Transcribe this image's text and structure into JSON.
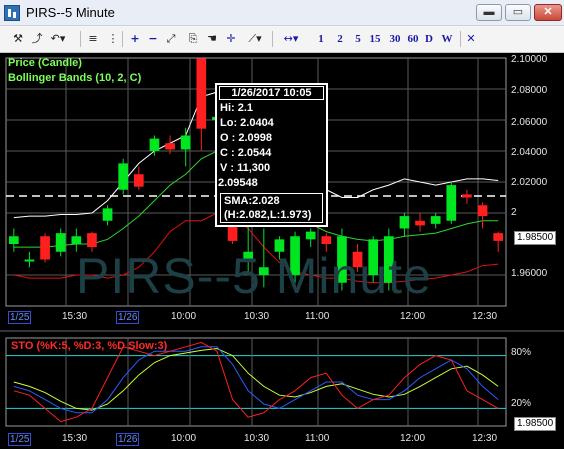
{
  "window": {
    "title": "PIRS--5 Minute",
    "buttons": [
      "▭",
      "▭",
      "✕"
    ]
  },
  "toolbar": {
    "icons": [
      "wrench-icon",
      "line-chart-icon",
      "undo-icon",
      "align-icon",
      "zoom-in-icon",
      "zoom-out-icon",
      "fit-icon",
      "hand-icon",
      "crosshair-icon",
      "draw-line-icon",
      "scroll-icon"
    ],
    "intervals": [
      "1",
      "2",
      "5",
      "15",
      "30",
      "60",
      "D",
      "W"
    ],
    "close": "✕"
  },
  "legend": {
    "price": "Price (Candle)",
    "bollinger": "Bollinger Bands (10, 2, C)"
  },
  "y_axis": [
    "2.10000",
    "2.08000",
    "2.06000",
    "2.04000",
    "2.02000",
    "2",
    "1.96000"
  ],
  "sto_axis": [
    "80%",
    "20%"
  ],
  "time_labels": [
    "15:30",
    "10:00",
    "10:30",
    "11:00",
    "12:00",
    "12:30"
  ],
  "date_labels": [
    "1/25",
    "1/26"
  ],
  "price_tag": "1.98500",
  "sto_tag": "1.98500",
  "tooltip": {
    "header": "1/26/2017 10:05",
    "hi": "Hi:  2.1",
    "lo": "Lo:  2.0404",
    "open": "O :  2.0998",
    "close": "C :  2.0544",
    "volume": "V :  11,300",
    "extra": "2.09548",
    "sma": "SMA:2.028",
    "sma_range": "(H:2.082,L:1.973)"
  },
  "watermark": "PIRS--5 Minute",
  "sto_label": "STO (%K:5, %D:3, %D Slow:3)",
  "colors": {
    "up": "#00e620",
    "down": "#ff1f1f",
    "bb_upper": "#ffffff",
    "bb_mid": "#2fd52f",
    "bb_lower": "#e01010",
    "grid": "#9a9a9a"
  },
  "chart_data": {
    "type": "candlestick",
    "ylim": [
      1.94,
      2.1
    ],
    "candles": [
      {
        "o": 1.98,
        "h": 1.99,
        "l": 1.975,
        "c": 1.985
      },
      {
        "o": 1.97,
        "h": 1.975,
        "l": 1.965,
        "c": 1.97
      },
      {
        "o": 1.985,
        "h": 1.987,
        "l": 1.968,
        "c": 1.97
      },
      {
        "o": 1.975,
        "h": 1.99,
        "l": 1.972,
        "c": 1.987
      },
      {
        "o": 1.98,
        "h": 1.99,
        "l": 1.975,
        "c": 1.985
      },
      {
        "o": 1.987,
        "h": 1.988,
        "l": 1.975,
        "c": 1.978
      },
      {
        "o": 1.995,
        "h": 2.005,
        "l": 1.992,
        "c": 2.003
      },
      {
        "o": 2.015,
        "h": 2.035,
        "l": 2.012,
        "c": 2.032
      },
      {
        "o": 2.025,
        "h": 2.03,
        "l": 2.015,
        "c": 2.017
      },
      {
        "o": 2.04,
        "h": 2.05,
        "l": 2.037,
        "c": 2.048
      },
      {
        "o": 2.045,
        "h": 2.05,
        "l": 2.038,
        "c": 2.041
      },
      {
        "o": 2.041,
        "h": 2.055,
        "l": 2.03,
        "c": 2.05
      },
      {
        "o": 2.0998,
        "h": 2.1,
        "l": 2.0404,
        "c": 2.0544
      },
      {
        "o": 2.06,
        "h": 2.07,
        "l": 2.055,
        "c": 2.062
      },
      {
        "o": 1.995,
        "h": 2.0,
        "l": 1.98,
        "c": 1.982
      },
      {
        "o": 1.97,
        "h": 2.0,
        "l": 1.962,
        "c": 1.975
      },
      {
        "o": 1.96,
        "h": 1.99,
        "l": 1.952,
        "c": 1.965
      },
      {
        "o": 1.975,
        "h": 1.985,
        "l": 1.97,
        "c": 1.983
      },
      {
        "o": 1.96,
        "h": 1.988,
        "l": 1.955,
        "c": 1.985
      },
      {
        "o": 1.983,
        "h": 1.99,
        "l": 1.978,
        "c": 1.988
      },
      {
        "o": 1.985,
        "h": 1.987,
        "l": 1.975,
        "c": 1.98
      },
      {
        "o": 1.955,
        "h": 1.99,
        "l": 1.95,
        "c": 1.985
      },
      {
        "o": 1.975,
        "h": 1.98,
        "l": 1.962,
        "c": 1.965
      },
      {
        "o": 1.96,
        "h": 1.985,
        "l": 1.955,
        "c": 1.983
      },
      {
        "o": 1.955,
        "h": 1.99,
        "l": 1.95,
        "c": 1.985
      },
      {
        "o": 1.99,
        "h": 2.0,
        "l": 1.985,
        "c": 1.998
      },
      {
        "o": 1.995,
        "h": 2.0,
        "l": 1.988,
        "c": 1.992
      },
      {
        "o": 1.993,
        "h": 2.0,
        "l": 1.99,
        "c": 1.998
      },
      {
        "o": 1.995,
        "h": 2.02,
        "l": 1.993,
        "c": 2.018
      },
      {
        "o": 2.012,
        "h": 2.015,
        "l": 2.006,
        "c": 2.01
      },
      {
        "o": 2.005,
        "h": 2.007,
        "l": 1.99,
        "c": 1.998
      },
      {
        "o": 1.987,
        "h": 1.988,
        "l": 1.975,
        "c": 1.982
      }
    ],
    "bb_upper": [
      1.997,
      1.998,
      1.998,
      1.999,
      1.999,
      2.0,
      2.008,
      2.02,
      2.032,
      2.04,
      2.045,
      2.05,
      2.075,
      2.078,
      2.07,
      2.06,
      2.05,
      2.035,
      2.025,
      2.02,
      2.015,
      2.01,
      2.01,
      2.015,
      2.018,
      2.022,
      2.02,
      2.018,
      2.02,
      2.022,
      2.022,
      2.021
    ],
    "bb_mid": [
      1.978,
      1.978,
      1.978,
      1.979,
      1.98,
      1.98,
      1.983,
      1.99,
      1.998,
      2.008,
      2.018,
      2.025,
      2.035,
      2.04,
      2.035,
      2.025,
      2.015,
      2.005,
      1.998,
      1.993,
      1.988,
      1.985,
      1.983,
      1.982,
      1.983,
      1.985,
      1.986,
      1.987,
      1.99,
      1.993,
      1.995,
      1.995
    ],
    "bb_lower": [
      1.96,
      1.958,
      1.958,
      1.958,
      1.96,
      1.96,
      1.958,
      1.96,
      1.965,
      1.975,
      1.988,
      1.995,
      1.995,
      2.0,
      1.998,
      1.99,
      1.978,
      1.968,
      1.962,
      1.96,
      1.958,
      1.958,
      1.956,
      1.955,
      1.955,
      1.956,
      1.957,
      1.958,
      1.96,
      1.962,
      1.966,
      1.967
    ],
    "sma_line": 2.011,
    "sto_k": [
      40,
      35,
      20,
      5,
      10,
      20,
      55,
      90,
      85,
      80,
      85,
      90,
      95,
      85,
      30,
      10,
      15,
      30,
      40,
      55,
      60,
      35,
      20,
      30,
      35,
      55,
      70,
      80,
      75,
      40,
      30,
      20
    ],
    "sto_d": [
      45,
      40,
      30,
      20,
      15,
      15,
      30,
      55,
      75,
      85,
      85,
      85,
      90,
      90,
      70,
      40,
      25,
      20,
      30,
      40,
      50,
      50,
      35,
      30,
      30,
      40,
      55,
      65,
      75,
      65,
      45,
      30
    ],
    "sto_slow": [
      50,
      45,
      38,
      28,
      20,
      18,
      25,
      40,
      58,
      72,
      80,
      83,
      86,
      88,
      80,
      60,
      45,
      35,
      33,
      38,
      45,
      48,
      42,
      36,
      33,
      36,
      45,
      55,
      65,
      68,
      58,
      45
    ]
  }
}
